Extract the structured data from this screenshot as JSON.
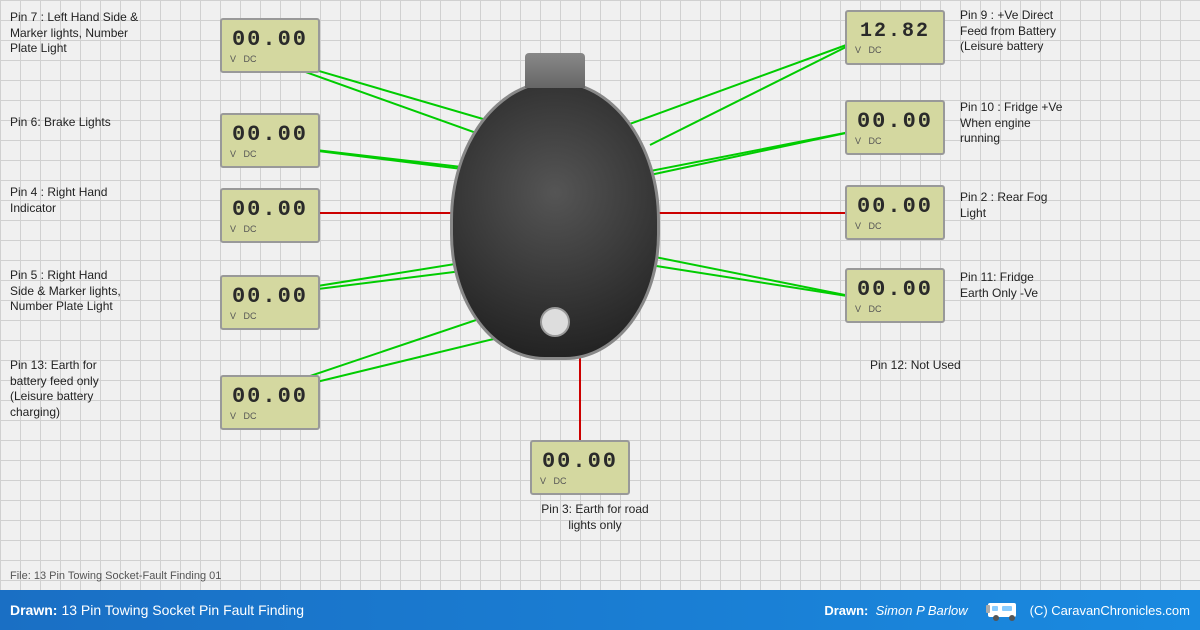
{
  "grid": true,
  "title": "13 Pin Towing Socket Pin Fault Finding",
  "drawn_label": "Drawn:",
  "drawn_by": "Simon P Barlow",
  "copyright": "(C) CaravanChronicles.com",
  "file_label": "File: 13 Pin Towing Socket-Fault Finding 01",
  "pins": [
    {
      "id": "pin7",
      "label": "Pin 7 : Left Hand Side &\nMarker lights, Number\nPlate Light",
      "lcd_value": "00.00",
      "lcd_big": false
    },
    {
      "id": "pin6",
      "label": "Pin 6: Brake Lights",
      "lcd_value": "00.00",
      "lcd_big": false
    },
    {
      "id": "pin4",
      "label": "Pin 4 : Right Hand\nIndicator",
      "lcd_value": "00.00",
      "lcd_big": false
    },
    {
      "id": "pin5",
      "label": "Pin 5 : Right Hand\nSide & Marker lights,\nNumber Plate Light",
      "lcd_value": "00.00",
      "lcd_big": false
    },
    {
      "id": "pin13",
      "label": "Pin 13: Earth for\nbattery feed only\n(Leisure battery\ncharging)",
      "lcd_value": "00.00",
      "lcd_big": false
    },
    {
      "id": "pin9",
      "label": "Pin 9 : +Ve Direct\nFeed from Battery\n(Leisure battery",
      "lcd_value": "12.82",
      "lcd_big": true
    },
    {
      "id": "pin10",
      "label": "Pin 10 : Fridge +Ve\nWhen engine\nrunning",
      "lcd_value": "00.00",
      "lcd_big": false
    },
    {
      "id": "pin2",
      "label": "Pin 2 : Rear Fog\nLight",
      "lcd_value": "00.00",
      "lcd_big": false
    },
    {
      "id": "pin11",
      "label": "Pin 11: Fridge\nEarth Only -Ve",
      "lcd_value": "00.00",
      "lcd_big": false
    },
    {
      "id": "pin12",
      "label": "Pin 12: Not Used",
      "lcd_value": null,
      "lcd_big": false
    },
    {
      "id": "pin3",
      "label": "Pin 3: Earth for road\nlights only",
      "lcd_value": "00.00",
      "lcd_big": false
    }
  ],
  "colors": {
    "green_line": "#00cc00",
    "red_line": "#cc0000",
    "footer_bg_start": "#1a6fc4",
    "footer_bg_end": "#1a8ae0"
  }
}
